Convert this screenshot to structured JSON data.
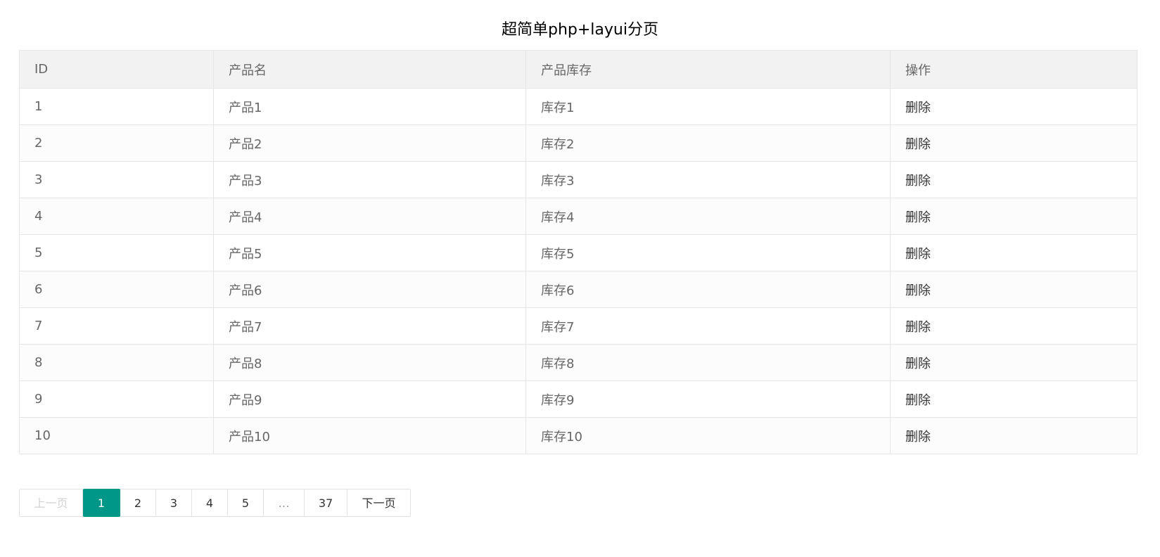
{
  "title": "超简单php+layui分页",
  "table": {
    "headers": [
      "ID",
      "产品名",
      "产品库存",
      "操作"
    ],
    "rows": [
      {
        "id": "1",
        "name": "产品1",
        "stock": "库存1",
        "action": "删除"
      },
      {
        "id": "2",
        "name": "产品2",
        "stock": "库存2",
        "action": "删除"
      },
      {
        "id": "3",
        "name": "产品3",
        "stock": "库存3",
        "action": "删除"
      },
      {
        "id": "4",
        "name": "产品4",
        "stock": "库存4",
        "action": "删除"
      },
      {
        "id": "5",
        "name": "产品5",
        "stock": "库存5",
        "action": "删除"
      },
      {
        "id": "6",
        "name": "产品6",
        "stock": "库存6",
        "action": "删除"
      },
      {
        "id": "7",
        "name": "产品7",
        "stock": "库存7",
        "action": "删除"
      },
      {
        "id": "8",
        "name": "产品8",
        "stock": "库存8",
        "action": "删除"
      },
      {
        "id": "9",
        "name": "产品9",
        "stock": "库存9",
        "action": "删除"
      },
      {
        "id": "10",
        "name": "产品10",
        "stock": "库存10",
        "action": "删除"
      }
    ]
  },
  "pagination": {
    "prev_label": "上一页",
    "pages": [
      "1",
      "2",
      "3",
      "4",
      "5"
    ],
    "ellipsis": "…",
    "last_page": "37",
    "next_label": "下一页",
    "current_page": "1"
  },
  "colors": {
    "accent": "#009688",
    "header_bg": "#f2f2f2",
    "border": "#e6e6e6"
  }
}
